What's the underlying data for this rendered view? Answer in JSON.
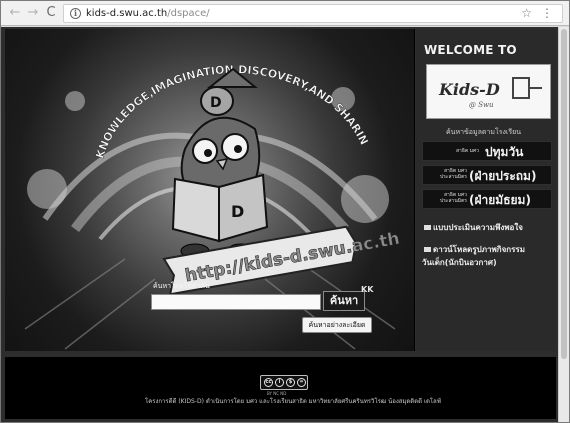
{
  "browser": {
    "url_host": "kids-d.swu.ac.th",
    "url_path": "/dspace/",
    "back_icon": "←",
    "forward_icon": "→",
    "reload_icon": "C",
    "info_icon": "i",
    "star_icon": "☆",
    "menu_icon": "⋮"
  },
  "hero": {
    "arc_text": "KNOWLEDGE,IMAGINATION,DISCOVERY,AND SHARING",
    "mascot_letter": "D",
    "book_letter": "D",
    "url_banner": "http://kids-d.swu.ac.th",
    "search_label": "ค้นหาโดยใช้คำค้น",
    "search_value": "",
    "search_button": "ค้นหา",
    "zoom_mark": "KK",
    "advanced_search": "ค้นหาอย่างละเอียด"
  },
  "panel": {
    "welcome": "WELCOME TO",
    "logo_text": "Kids-D",
    "logo_sub": "@ Swu",
    "heading": "ค้นหาข้อมูลตามโรงเรียน",
    "schools": [
      {
        "small": "สาธิต มศว",
        "big": "ปทุมวัน"
      },
      {
        "small": "สาธิต มศว ประสานมิตร",
        "big": "(ฝ่ายประถม)"
      },
      {
        "small": "สาธิต มศว ประสานมิตร",
        "big": "(ฝ่ายมัธยม)"
      }
    ],
    "links": [
      {
        "text": "แบบประเมินความพึงพอใจ"
      },
      {
        "text": "ดาวน์โหลดรูปภาพกิจกรรม",
        "text2": "วันเด็ก(นักบินอวกาศ)"
      }
    ]
  },
  "footer": {
    "cc": [
      "cc",
      "i",
      "$",
      "="
    ],
    "cc_caption": "BY NC ND",
    "text": "โครงการดีดี (KIDS-D) ดำเนินการโดย มศว และโรงเรียนสาธิต มหาวิทยาลัยศรีนครินทรวิโรฒ น้องสมุดดิดดี เดโลฟ์"
  },
  "colors": {
    "page_bg": "#2d2d2d",
    "footer_bg": "#000000",
    "panel_text": "#f3f3f3"
  }
}
